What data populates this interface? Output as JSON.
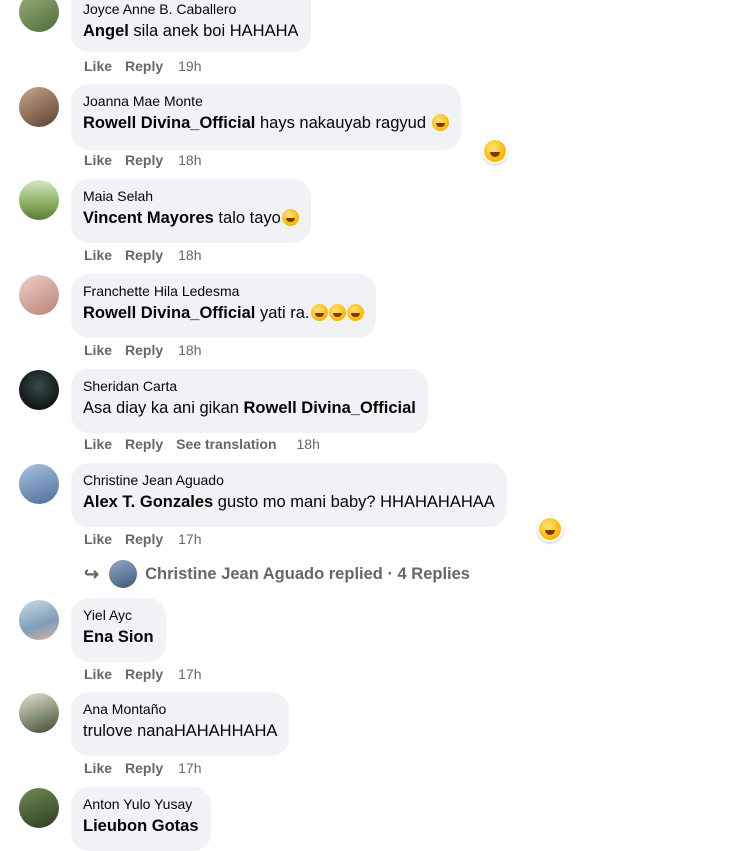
{
  "actions": {
    "like": "Like",
    "reply": "Reply",
    "see_translation": "See translation"
  },
  "comments": [
    {
      "author": "Joyce Anne B. Caballero",
      "mention": "Angel",
      "text": " sila anek boi HAHAHA",
      "time": "19h"
    },
    {
      "author": "Joanna Mae Monte",
      "mention": "Rowell Divina_Official",
      "text": " hays nakauyab ragyud",
      "time": "18h"
    },
    {
      "author": "Maia Selah",
      "mention": "Vincent Mayores",
      "text": " talo tayo",
      "time": "18h"
    },
    {
      "author": "Franchette Hila Ledesma",
      "mention": "Rowell Divina_Official",
      "text": " yati ra.",
      "time": "18h"
    },
    {
      "author": "Sheridan Carta",
      "text_before": "Asa diay ka ani gikan ",
      "mention": "Rowell Divina_Official",
      "time": "18h"
    },
    {
      "author": "Christine Jean Aguado",
      "mention": "Alex T. Gonzales",
      "text": " gusto mo mani baby? HHAHAHAHAA",
      "time": "17h"
    },
    {
      "author": "Yiel Ayc",
      "mention": "Ena Sion",
      "time": "17h"
    },
    {
      "author": "Ana Montaño",
      "text": "trulove nanaHAHAHHAHA",
      "time": "17h"
    },
    {
      "author": "Anton Yulo Yusay",
      "mention": "Lieubon Gotas"
    }
  ],
  "replies_link": {
    "text": "Christine Jean Aguado replied · 4 Replies"
  },
  "icons": {
    "reply_arrow": "reply-arrow-icon",
    "emoji": "laughing-emoji-icon"
  }
}
